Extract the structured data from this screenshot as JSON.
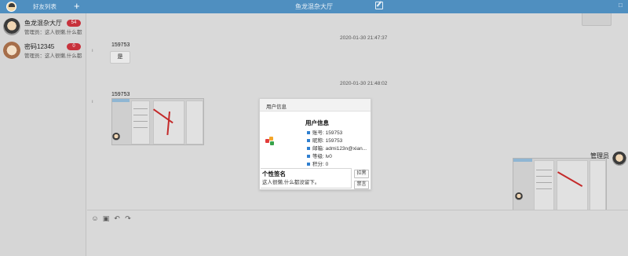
{
  "topbar": {
    "friends_label": "好友列表",
    "add_symbol": "+",
    "room_title": "鱼龙混杂大厅",
    "window_symbol": "□"
  },
  "sidebar": {
    "items": [
      {
        "name": "鱼龙混杂大厅",
        "preview": "管理员：这人很懒,什么都没...",
        "badge": "54"
      },
      {
        "name": "密码12345",
        "preview": "管理员：这人很懒,什么都...",
        "badge": "0"
      }
    ]
  },
  "chat": {
    "messages": [
      {
        "time": "2020-01-30 21:47:37",
        "sender": "159753",
        "text": "是"
      },
      {
        "time": "2020-01-30 21:48:02",
        "sender": "159753"
      }
    ],
    "admin_name": "管理员"
  },
  "toolbar": {
    "icons": [
      "emoji-icon",
      "image-icon",
      "undo-icon",
      "redo-icon"
    ]
  },
  "modal": {
    "title": "用户信息",
    "info_title": "用户信息",
    "fields": [
      "账号: 159753",
      "昵称: 159753",
      "邮箱: admi123n@xian...",
      "等级: lv0",
      "积分: 0"
    ],
    "signature_title": "个性签名",
    "signature_text": "这人很懒,什么都没留下。",
    "buttons": {
      "block": "拉黑",
      "mute": "禁言"
    }
  }
}
